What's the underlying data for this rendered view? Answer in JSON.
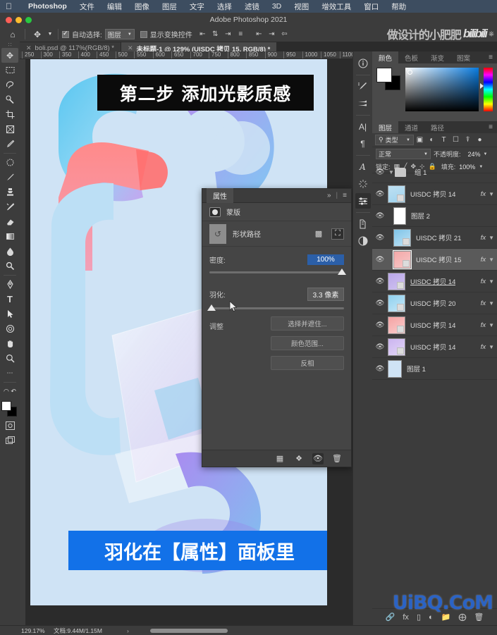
{
  "macmenu": {
    "apple": "apple-logo",
    "items": [
      "Photoshop",
      "文件",
      "编辑",
      "图像",
      "图层",
      "文字",
      "选择",
      "滤镜",
      "3D",
      "视图",
      "增效工具",
      "窗口",
      "帮助"
    ]
  },
  "titlebar": {
    "title": "Adobe Photoshop 2021"
  },
  "optionsbar": {
    "home_icon": "home-icon",
    "tool_icon": "move-tool-icon",
    "auto_select_label": "自动选择:",
    "auto_select_value": "图层",
    "show_transform_label": "显示变换控件",
    "align_icons": [
      "align-left-icon",
      "align-center-h-icon",
      "align-right-icon",
      "distribute-h-icon",
      "align-top-icon",
      "align-middle-v-icon",
      "align-bottom-icon"
    ],
    "watermark_cn": "做设计的小肥肥",
    "watermark_brand": "bilibili"
  },
  "doctabs": [
    {
      "label": "boli.psd @ 117%(RGB/8) *",
      "active": false
    },
    {
      "label": "未标题-1 @ 129% (UISDC 拷贝 15, RGB/8) *",
      "active": true
    }
  ],
  "ruler": {
    "ticks": [
      "250",
      "300",
      "350",
      "400",
      "450",
      "500",
      "550",
      "600",
      "650",
      "700",
      "750",
      "800",
      "850",
      "900",
      "950",
      "1000",
      "1050",
      "1100"
    ]
  },
  "toolbar": {
    "tools": [
      {
        "name": "move-tool",
        "glyph": "✥",
        "selected": true
      },
      {
        "name": "marquee-tool",
        "glyph": "▭",
        "selected": false
      },
      {
        "name": "lasso-tool",
        "glyph": "⌁",
        "selected": false
      },
      {
        "name": "quick-selection-tool",
        "glyph": "✎",
        "selected": false
      },
      {
        "name": "crop-tool",
        "glyph": "⌗",
        "selected": false
      },
      {
        "name": "frame-tool",
        "glyph": "▤",
        "selected": false
      },
      {
        "name": "eyedropper-tool",
        "glyph": "⚲",
        "selected": false
      },
      {
        "name": "spot-healing-tool",
        "glyph": "✺",
        "selected": false
      },
      {
        "name": "brush-tool",
        "glyph": "✒",
        "selected": false
      },
      {
        "name": "clone-stamp-tool",
        "glyph": "⚗",
        "selected": false
      },
      {
        "name": "history-brush-tool",
        "glyph": "✐",
        "selected": false
      },
      {
        "name": "eraser-tool",
        "glyph": "◣",
        "selected": false
      },
      {
        "name": "gradient-tool",
        "glyph": "▥",
        "selected": false
      },
      {
        "name": "blur-tool",
        "glyph": "💧",
        "selected": false
      },
      {
        "name": "dodge-tool",
        "glyph": "🔍",
        "selected": false
      },
      {
        "name": "pen-tool",
        "glyph": "✑",
        "selected": false
      },
      {
        "name": "type-tool",
        "glyph": "T",
        "selected": false
      },
      {
        "name": "path-selection-tool",
        "glyph": "➤",
        "selected": false
      },
      {
        "name": "ellipse-shape-tool",
        "glyph": "◎",
        "selected": false
      },
      {
        "name": "hand-tool",
        "glyph": "✋",
        "selected": false
      },
      {
        "name": "zoom-tool",
        "glyph": "🔎",
        "selected": false
      },
      {
        "name": "more-tools",
        "glyph": "•••",
        "selected": false
      }
    ],
    "swatch_fg": "#ffffff",
    "swatch_bg": "#000000",
    "quickmask_icon": "quick-mask-icon",
    "screenmode_icon": "screen-mode-icon"
  },
  "canvas": {
    "banner_top": "第二步 添加光影质感",
    "banner_bottom": "羽化在【属性】面板里",
    "banner_bottom_color": "#1271e8",
    "artboard_bg": "#cfe3f5"
  },
  "properties": {
    "tab_label": "属性",
    "collapse_icon": "chevron-double-right-icon",
    "menu_icon": "panel-menu-icon",
    "mask_label": "蒙版",
    "mask_type_label": "形状路径",
    "mask_btn_1": "select-mask-icon",
    "mask_btn_2": "mask-options-icon",
    "density_label": "密度:",
    "density_value": "100%",
    "feather_label": "羽化:",
    "feather_value": "3.3 像素",
    "adjust_label": "调整",
    "buttons": [
      "选择并遮住...",
      "颜色范围...",
      "反相"
    ],
    "footer_icons": [
      "load-selection-icon",
      "apply-mask-icon",
      "toggle-mask-icon",
      "delete-mask-icon"
    ]
  },
  "rail": {
    "icons": [
      {
        "name": "info-panel-icon",
        "glyph": "ⓘ",
        "selected": false
      },
      {
        "name": "brush-settings-icon",
        "glyph": "✜",
        "selected": false
      },
      {
        "name": "brushes-icon",
        "glyph": "⟺",
        "selected": false
      },
      {
        "name": "character-panel-icon",
        "glyph": "A",
        "selected": false
      },
      {
        "name": "paragraph-panel-icon",
        "glyph": "¶",
        "selected": false
      },
      {
        "name": "glyphs-panel-icon",
        "glyph": "𝓐",
        "selected": false
      },
      {
        "name": "libraries-panel-icon",
        "glyph": "✳",
        "selected": false
      },
      {
        "name": "adjustments-panel-icon",
        "glyph": "⚙",
        "selected": true
      },
      {
        "name": "history-panel-icon",
        "glyph": "⎌",
        "selected": false
      },
      {
        "name": "actions-panel-icon",
        "glyph": "◑",
        "selected": false
      }
    ]
  },
  "colorpanel": {
    "tabs": [
      {
        "label": "颜色",
        "active": true
      },
      {
        "label": "色板",
        "active": false
      },
      {
        "label": "渐变",
        "active": false
      },
      {
        "label": "图案",
        "active": false
      }
    ],
    "menu_icon": "panel-menu-icon",
    "fg": "#ffffff",
    "bg": "#000000"
  },
  "layers": {
    "tabs": [
      {
        "label": "图层",
        "active": true
      },
      {
        "label": "通道",
        "active": false
      },
      {
        "label": "路径",
        "active": false
      }
    ],
    "menu_icon": "panel-menu-icon",
    "filter": {
      "search_icon": "search-icon",
      "kind_label": "类型",
      "icons": [
        "filter-pixel-icon",
        "filter-adjustment-icon",
        "filter-type-icon",
        "filter-shape-icon",
        "filter-smart-icon",
        "filter-toggle-icon"
      ]
    },
    "blend_mode": "正常",
    "opacity_label": "不透明度:",
    "opacity_value": "24%",
    "lock_label": "锁定:",
    "lock_icons": [
      "lock-transparent-icon",
      "lock-image-icon",
      "lock-position-icon",
      "lock-nesting-icon",
      "lock-all-icon"
    ],
    "fill_label": "填充:",
    "fill_value": "100%",
    "rows": [
      {
        "name": "组 1",
        "type": "group",
        "visible": true,
        "expanded": true,
        "fx": false,
        "selected": false,
        "thumb_a": "#c9c9c9",
        "thumb_b": "#c9c9c9"
      },
      {
        "name": "UISDC 拷贝 14",
        "type": "layer",
        "visible": true,
        "indent": true,
        "fx": true,
        "selected": false,
        "thumb_a": "#bfe0f2",
        "thumb_b": "#9fd3ee"
      },
      {
        "name": "图层 2",
        "type": "layer",
        "visible": true,
        "indent": true,
        "fx": false,
        "selected": false,
        "thumb_a": "#ffffff",
        "thumb_b": "#ffffff"
      },
      {
        "name": "UISDC 拷贝 21",
        "type": "layer",
        "visible": true,
        "indent": true,
        "fx": true,
        "selected": false,
        "thumb_a": "#7fc4e8",
        "thumb_b": "#bfe2f5"
      },
      {
        "name": "UISDC 拷贝 15",
        "type": "layer",
        "visible": true,
        "indent": true,
        "fx": true,
        "selected": true,
        "thumb_a": "#f4a8a8",
        "thumb_b": "#f7c9c9"
      },
      {
        "name": "UISDC 拷贝 14",
        "type": "layer",
        "visible": true,
        "indent": false,
        "fx": true,
        "selected": false,
        "underline": true,
        "thumb_a": "#b9a6e8",
        "thumb_b": "#d0c3f0"
      },
      {
        "name": "UISDC 拷贝 20",
        "type": "layer",
        "visible": true,
        "indent": false,
        "fx": true,
        "selected": false,
        "thumb_a": "#8fd0ee",
        "thumb_b": "#c6e7f7"
      },
      {
        "name": "UISDC 拷贝 14",
        "type": "layer",
        "visible": true,
        "indent": false,
        "fx": true,
        "selected": false,
        "thumb_a": "#f5a3a3",
        "thumb_b": "#f9cccc"
      },
      {
        "name": "UISDC 拷贝 14",
        "type": "layer",
        "visible": true,
        "indent": false,
        "fx": true,
        "selected": false,
        "thumb_a": "#cbb4ef",
        "thumb_b": "#e2d6f7"
      },
      {
        "name": "图层 1",
        "type": "layer",
        "visible": true,
        "indent": false,
        "fx": false,
        "selected": false,
        "thumb_a": "#cfe3f5",
        "thumb_b": "#cfe3f5"
      }
    ],
    "footer_icons": [
      "link-layers-icon",
      "layer-style-icon",
      "add-mask-icon",
      "adjustment-layer-icon",
      "new-group-icon",
      "new-layer-icon",
      "delete-layer-icon"
    ],
    "watermark": "UiBQ.CoM"
  },
  "statusbar": {
    "zoom": "129.17%",
    "doc": "文档:9.44M/1.15M",
    "arrow": "›"
  }
}
